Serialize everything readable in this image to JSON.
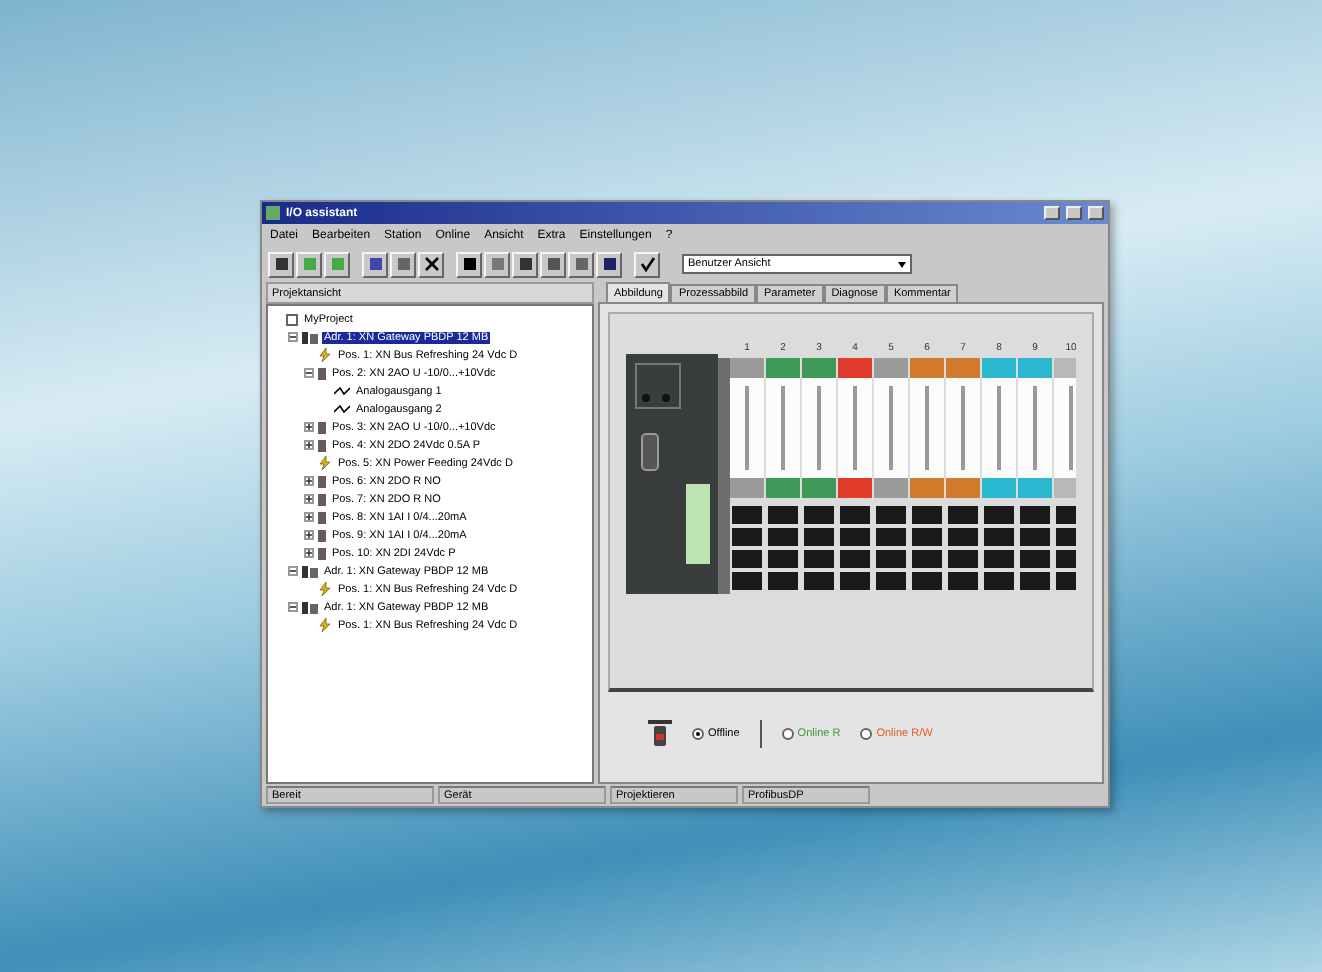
{
  "window": {
    "title": "I/O assistant"
  },
  "menu": [
    "Datei",
    "Bearbeiten",
    "Station",
    "Online",
    "Ansicht",
    "Extra",
    "Einstellungen",
    "?"
  ],
  "view_select": {
    "value": "Benutzer Ansicht"
  },
  "project_panel": {
    "title": "Projektansicht"
  },
  "tree": [
    {
      "label": "MyProject",
      "kind": "project",
      "selected": false,
      "children": [
        {
          "label": "Adr. 1: XN Gateway PBDP 12 MB",
          "kind": "gateway",
          "selected": true,
          "expanded": true,
          "children": [
            {
              "label": "Pos. 1: XN Bus Refreshing 24 Vdc D",
              "kind": "power",
              "selected": false
            },
            {
              "label": "Pos. 2: XN 2AO U -10/0...+10Vdc",
              "kind": "module",
              "selected": false,
              "expanded": true,
              "children": [
                {
                  "label": "Analogausgang 1",
                  "kind": "channel",
                  "selected": false
                },
                {
                  "label": "Analogausgang 2",
                  "kind": "channel",
                  "selected": false
                }
              ]
            },
            {
              "label": "Pos. 3: XN 2AO U -10/0...+10Vdc",
              "kind": "module",
              "selected": false,
              "expanded": false
            },
            {
              "label": "Pos. 4: XN 2DO 24Vdc 0.5A P",
              "kind": "module",
              "selected": false,
              "expanded": false
            },
            {
              "label": "Pos. 5: XN Power Feeding 24Vdc D",
              "kind": "power",
              "selected": false
            },
            {
              "label": "Pos. 6: XN 2DO R NO",
              "kind": "module",
              "selected": false,
              "expanded": false
            },
            {
              "label": "Pos. 7: XN 2DO R NO",
              "kind": "module",
              "selected": false,
              "expanded": false
            },
            {
              "label": "Pos. 8: XN 1AI I 0/4...20mA",
              "kind": "module",
              "selected": false,
              "expanded": false
            },
            {
              "label": "Pos. 9: XN 1AI I 0/4...20mA",
              "kind": "module",
              "selected": false,
              "expanded": false
            },
            {
              "label": "Pos. 10: XN 2DI 24Vdc P",
              "kind": "module",
              "selected": false,
              "expanded": false
            }
          ]
        },
        {
          "label": "Adr. 1: XN Gateway PBDP 12 MB",
          "kind": "gateway",
          "selected": false,
          "expanded": true,
          "children": [
            {
              "label": "Pos. 1: XN Bus Refreshing 24 Vdc D",
              "kind": "power",
              "selected": false
            }
          ]
        },
        {
          "label": "Adr. 1: XN Gateway PBDP 12 MB",
          "kind": "gateway",
          "selected": false,
          "expanded": true,
          "children": [
            {
              "label": "Pos. 1: XN Bus Refreshing 24 Vdc D",
              "kind": "power",
              "selected": false
            }
          ]
        }
      ]
    }
  ],
  "tabs": [
    {
      "label": "Abbildung",
      "selected": true
    },
    {
      "label": "Prozessabbild",
      "selected": false
    },
    {
      "label": "Parameter",
      "selected": false
    },
    {
      "label": "Diagnose",
      "selected": false
    },
    {
      "label": "Kommentar",
      "selected": false
    }
  ],
  "modules": [
    {
      "label": "1",
      "color": "#9a9a9a"
    },
    {
      "label": "2",
      "color": "#3f9a5a"
    },
    {
      "label": "3",
      "color": "#3f9a5a"
    },
    {
      "label": "4",
      "color": "#e03a2a"
    },
    {
      "label": "5",
      "color": "#9a9a9a"
    },
    {
      "label": "6",
      "color": "#d07a2a"
    },
    {
      "label": "7",
      "color": "#d07a2a"
    },
    {
      "label": "8",
      "color": "#2ab8d0"
    },
    {
      "label": "9",
      "color": "#2ab8d0"
    },
    {
      "label": "10",
      "color": "#b8b8b8"
    }
  ],
  "mode": [
    {
      "label": "Offline",
      "selected": true,
      "color": "#000000"
    },
    {
      "label": "Online R",
      "selected": false,
      "color": "#3a9a3a"
    },
    {
      "label": "Online R/W",
      "selected": false,
      "color": "#e05a2a"
    }
  ],
  "status_bar": [
    "Bereit",
    "Gerät",
    "Projektieren",
    "ProfibusDP"
  ]
}
